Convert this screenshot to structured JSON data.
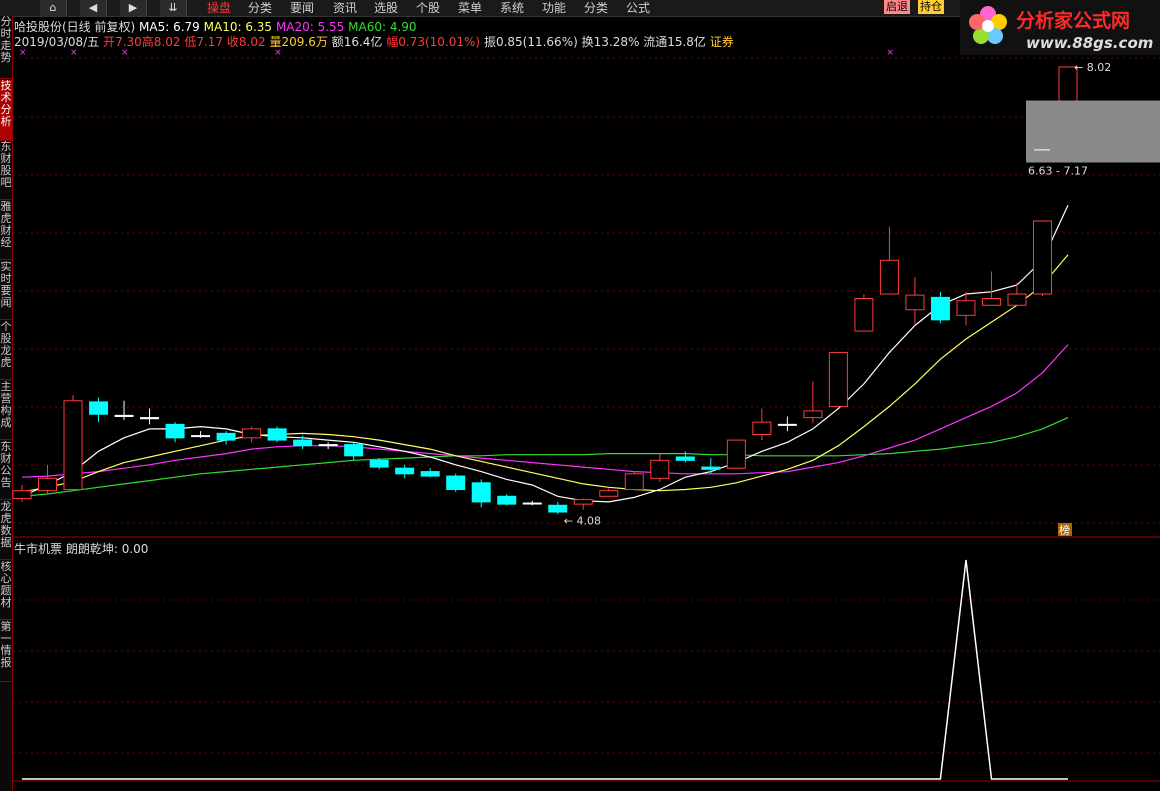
{
  "nav": {
    "home_icon": "home-icon",
    "back_icon": "left-arrow-icon",
    "forward_icon": "right-arrow-icon",
    "down_icon": "double-chevron-down-icon"
  },
  "menu": [
    "操盘",
    "分类",
    "要闻",
    "资讯",
    "选股",
    "个股",
    "菜单",
    "系统",
    "功能",
    "分类",
    "公式"
  ],
  "menu_active": 0,
  "tags": [
    "启退",
    "持仓"
  ],
  "logo": {
    "title": "分析家公式网",
    "url": "www.88gs.com"
  },
  "sidebar": [
    "分时走势",
    "技术分析",
    "东财股吧",
    "雅虎财经",
    "实时要闻",
    "个股龙虎",
    "主营构成",
    "东财公告",
    "龙虎数据",
    "核心题材",
    "第一情报"
  ],
  "sidebar_active": 1,
  "header": {
    "stock": "哈投股份(日线 前复权)",
    "ma5": "MA5: 6.79",
    "ma10": "MA10: 6.35",
    "ma20": "MA20: 5.55",
    "ma60": "MA60: 4.90",
    "date": "2019/03/08/五",
    "open_label": "开",
    "open": "7.30",
    "high_label": "高",
    "high": "8.02",
    "low_label": "低",
    "low": "7.17",
    "close_label": "收",
    "close": "8.02",
    "vol_label": "量",
    "vol": "209.6万",
    "amount_label": "额",
    "amount": "16.4亿",
    "chg_label": "幅",
    "chg": "0.73(10.01%)",
    "amp": "振0.85(11.66%)",
    "turn": "换13.28%",
    "float": "流通15.8亿",
    "sector": "证券"
  },
  "annotations": {
    "high_label": "8.02",
    "low_label": "4.08",
    "range_label": "6.63 - 7.17",
    "bang_label": "榜"
  },
  "indicator": {
    "title": "牛市机票",
    "name": "朗朗乾坤: 0.00"
  },
  "colors": {
    "up": "#ff3b3b",
    "down": "#00ffff",
    "ma5": "#ffffff",
    "ma10": "#ffff66",
    "ma20": "#ff33ff",
    "ma60": "#33dd33",
    "grid": "#7a0000"
  },
  "chart_data": {
    "type": "candlestick",
    "y_range": [
      3.9,
      8.1
    ],
    "candles": [
      {
        "o": 4.18,
        "h": 4.3,
        "l": 4.15,
        "c": 4.25
      },
      {
        "o": 4.25,
        "h": 4.48,
        "l": 4.22,
        "c": 4.36
      },
      {
        "o": 4.26,
        "h": 5.1,
        "l": 4.26,
        "c": 5.05
      },
      {
        "o": 5.04,
        "h": 5.08,
        "l": 4.86,
        "c": 4.93
      },
      {
        "o": 4.92,
        "h": 5.05,
        "l": 4.88,
        "c": 4.91
      },
      {
        "o": 4.9,
        "h": 4.98,
        "l": 4.84,
        "c": 4.89
      },
      {
        "o": 4.84,
        "h": 4.86,
        "l": 4.68,
        "c": 4.72
      },
      {
        "o": 4.74,
        "h": 4.78,
        "l": 4.72,
        "c": 4.74
      },
      {
        "o": 4.76,
        "h": 4.78,
        "l": 4.66,
        "c": 4.7
      },
      {
        "o": 4.72,
        "h": 4.82,
        "l": 4.68,
        "c": 4.8
      },
      {
        "o": 4.8,
        "h": 4.82,
        "l": 4.68,
        "c": 4.7
      },
      {
        "o": 4.7,
        "h": 4.74,
        "l": 4.62,
        "c": 4.65
      },
      {
        "o": 4.65,
        "h": 4.68,
        "l": 4.62,
        "c": 4.66
      },
      {
        "o": 4.66,
        "h": 4.68,
        "l": 4.52,
        "c": 4.56
      },
      {
        "o": 4.52,
        "h": 4.54,
        "l": 4.44,
        "c": 4.46
      },
      {
        "o": 4.45,
        "h": 4.48,
        "l": 4.36,
        "c": 4.4
      },
      {
        "o": 4.42,
        "h": 4.45,
        "l": 4.37,
        "c": 4.38
      },
      {
        "o": 4.38,
        "h": 4.4,
        "l": 4.24,
        "c": 4.26
      },
      {
        "o": 4.32,
        "h": 4.35,
        "l": 4.1,
        "c": 4.15
      },
      {
        "o": 4.2,
        "h": 4.22,
        "l": 4.12,
        "c": 4.13
      },
      {
        "o": 4.14,
        "h": 4.16,
        "l": 4.12,
        "c": 4.14
      },
      {
        "o": 4.12,
        "h": 4.15,
        "l": 4.04,
        "c": 4.06
      },
      {
        "o": 4.13,
        "h": 4.18,
        "l": 4.08,
        "c": 4.17
      },
      {
        "o": 4.2,
        "h": 4.27,
        "l": 4.2,
        "c": 4.25
      },
      {
        "o": 4.26,
        "h": 4.42,
        "l": 4.26,
        "c": 4.4
      },
      {
        "o": 4.36,
        "h": 4.58,
        "l": 4.33,
        "c": 4.52
      },
      {
        "o": 4.55,
        "h": 4.6,
        "l": 4.5,
        "c": 4.52
      },
      {
        "o": 4.46,
        "h": 4.54,
        "l": 4.4,
        "c": 4.44
      },
      {
        "o": 4.45,
        "h": 4.7,
        "l": 4.45,
        "c": 4.7
      },
      {
        "o": 4.75,
        "h": 4.98,
        "l": 4.7,
        "c": 4.86
      },
      {
        "o": 4.84,
        "h": 4.91,
        "l": 4.78,
        "c": 4.84
      },
      {
        "o": 4.9,
        "h": 5.22,
        "l": 4.85,
        "c": 4.96
      },
      {
        "o": 5.0,
        "h": 5.48,
        "l": 5.0,
        "c": 5.48
      },
      {
        "o": 5.67,
        "h": 6.0,
        "l": 5.67,
        "c": 5.96
      },
      {
        "o": 6.0,
        "h": 6.6,
        "l": 6.01,
        "c": 6.3
      },
      {
        "o": 5.86,
        "h": 6.15,
        "l": 5.72,
        "c": 5.99
      },
      {
        "o": 5.97,
        "h": 6.02,
        "l": 5.74,
        "c": 5.77
      },
      {
        "o": 5.81,
        "h": 6.02,
        "l": 5.72,
        "c": 5.94
      },
      {
        "o": 5.9,
        "h": 6.2,
        "l": 5.9,
        "c": 5.96
      },
      {
        "o": 5.9,
        "h": 6.1,
        "l": 5.9,
        "c": 6.0
      },
      {
        "o": 6.0,
        "h": 6.65,
        "l": 5.98,
        "c": 6.65
      },
      {
        "o": 7.3,
        "h": 8.02,
        "l": 7.17,
        "c": 8.02
      }
    ],
    "ma5": [
      4.2,
      4.3,
      4.42,
      4.6,
      4.72,
      4.8,
      4.8,
      4.82,
      4.8,
      4.75,
      4.73,
      4.72,
      4.7,
      4.68,
      4.64,
      4.6,
      4.55,
      4.48,
      4.42,
      4.35,
      4.3,
      4.2,
      4.16,
      4.15,
      4.19,
      4.26,
      4.37,
      4.42,
      4.5,
      4.6,
      4.68,
      4.8,
      4.98,
      5.2,
      5.48,
      5.72,
      5.9,
      6.0,
      6.02,
      6.08,
      6.3,
      6.79
    ],
    "ma10": [
      4.24,
      4.28,
      4.33,
      4.42,
      4.5,
      4.55,
      4.6,
      4.65,
      4.7,
      4.74,
      4.75,
      4.76,
      4.75,
      4.73,
      4.7,
      4.66,
      4.62,
      4.56,
      4.51,
      4.46,
      4.41,
      4.36,
      4.31,
      4.28,
      4.26,
      4.25,
      4.26,
      4.28,
      4.32,
      4.38,
      4.44,
      4.52,
      4.65,
      4.82,
      5.0,
      5.2,
      5.42,
      5.6,
      5.75,
      5.9,
      6.08,
      6.35
    ],
    "ma20": [
      4.37,
      4.38,
      4.4,
      4.42,
      4.45,
      4.48,
      4.52,
      4.55,
      4.58,
      4.62,
      4.64,
      4.65,
      4.65,
      4.64,
      4.62,
      4.6,
      4.58,
      4.56,
      4.54,
      4.52,
      4.5,
      4.48,
      4.46,
      4.44,
      4.42,
      4.41,
      4.4,
      4.4,
      4.4,
      4.41,
      4.42,
      4.46,
      4.5,
      4.56,
      4.63,
      4.7,
      4.8,
      4.9,
      5.0,
      5.12,
      5.3,
      5.55
    ],
    "ma60": [
      4.2,
      4.22,
      4.25,
      4.28,
      4.31,
      4.34,
      4.37,
      4.4,
      4.42,
      4.44,
      4.46,
      4.48,
      4.5,
      4.52,
      4.53,
      4.54,
      4.55,
      4.56,
      4.56,
      4.57,
      4.57,
      4.57,
      4.57,
      4.58,
      4.58,
      4.58,
      4.58,
      4.57,
      4.57,
      4.56,
      4.56,
      4.56,
      4.56,
      4.57,
      4.58,
      4.6,
      4.62,
      4.65,
      4.68,
      4.73,
      4.8,
      4.9
    ],
    "indicator_values": [
      0,
      0,
      0,
      0,
      0,
      0,
      0,
      0,
      0,
      0,
      0,
      0,
      0,
      0,
      0,
      0,
      0,
      0,
      0,
      0,
      0,
      0,
      0,
      0,
      0,
      0,
      0,
      0,
      0,
      0,
      0,
      0,
      0,
      0,
      0,
      0,
      0,
      1,
      0,
      0,
      0,
      0
    ]
  }
}
